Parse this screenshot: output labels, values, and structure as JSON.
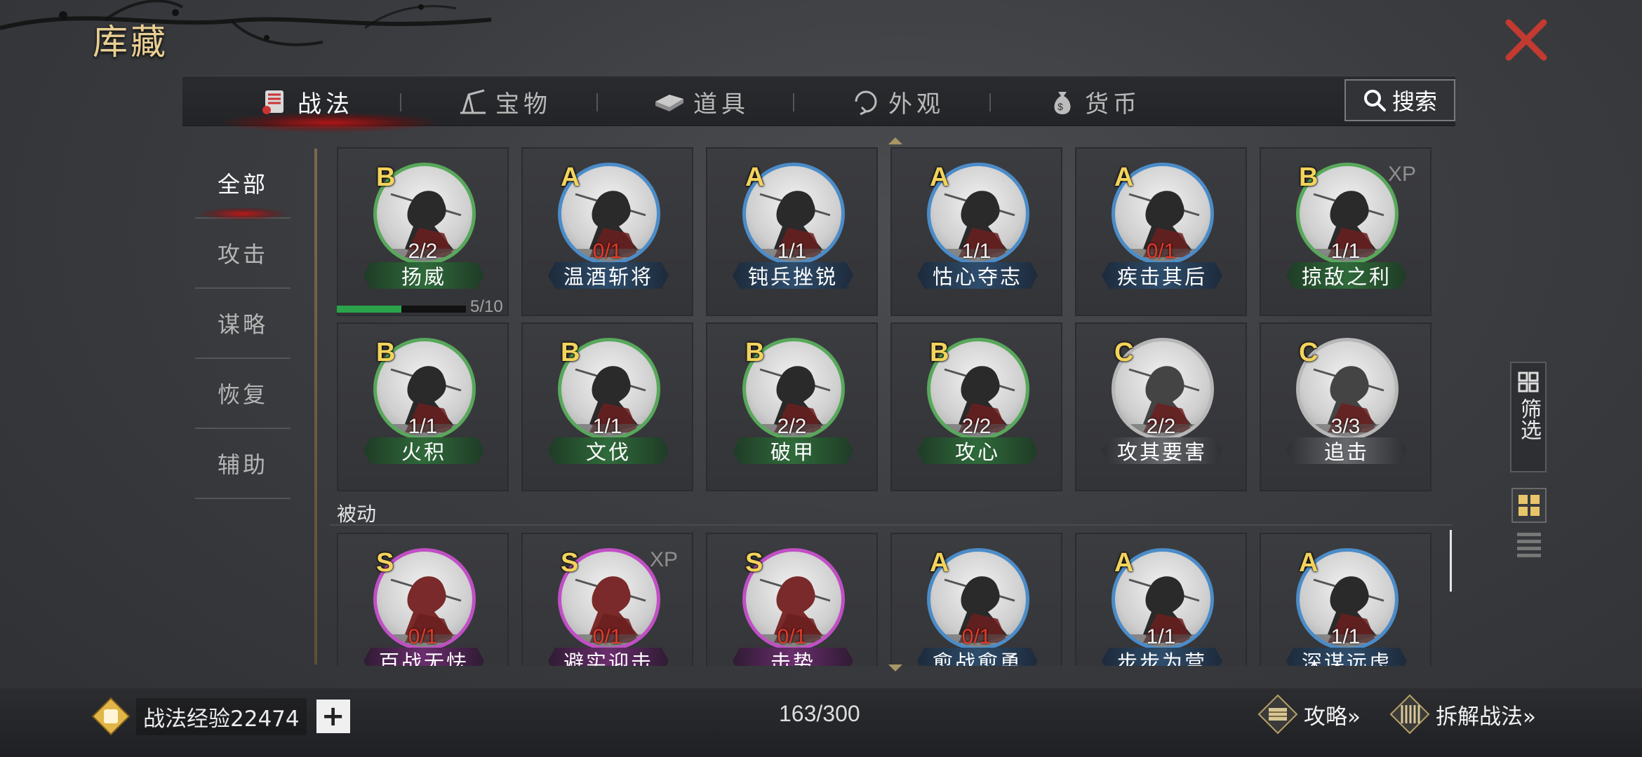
{
  "window": {
    "title": "库藏"
  },
  "tabs": [
    {
      "label": "战法",
      "icon": "scroll-icon",
      "active": true
    },
    {
      "label": "宝物",
      "icon": "treasure-icon",
      "active": false
    },
    {
      "label": "道具",
      "icon": "item-icon",
      "active": false
    },
    {
      "label": "外观",
      "icon": "appearance-icon",
      "active": false
    },
    {
      "label": "货币",
      "icon": "money-bag-icon",
      "active": false
    }
  ],
  "search": {
    "label": "搜索"
  },
  "categories": [
    {
      "label": "全部",
      "active": true
    },
    {
      "label": "攻击",
      "active": false
    },
    {
      "label": "谋略",
      "active": false
    },
    {
      "label": "恢复",
      "active": false
    },
    {
      "label": "辅助",
      "active": false
    }
  ],
  "active_cards_row1": [
    {
      "rank": "B",
      "count": "2/2",
      "name": "扬威",
      "ring": "green",
      "count_red": false,
      "xp": ""
    },
    {
      "rank": "A",
      "count": "0/1",
      "name": "温酒斩将",
      "ring": "blue",
      "count_red": true,
      "xp": ""
    },
    {
      "rank": "A",
      "count": "1/1",
      "name": "钝兵挫锐",
      "ring": "blue",
      "count_red": false,
      "xp": ""
    },
    {
      "rank": "A",
      "count": "1/1",
      "name": "怙心夺志",
      "ring": "blue",
      "count_red": false,
      "xp": ""
    },
    {
      "rank": "A",
      "count": "0/1",
      "name": "疾击其后",
      "ring": "blue",
      "count_red": true,
      "xp": ""
    },
    {
      "rank": "B",
      "count": "1/1",
      "name": "掠敌之利",
      "ring": "green",
      "count_red": false,
      "xp": "XP"
    }
  ],
  "active_cards_row2": [
    {
      "rank": "B",
      "count": "1/1",
      "name": "火积",
      "ring": "green",
      "count_red": false,
      "xp": ""
    },
    {
      "rank": "B",
      "count": "1/1",
      "name": "文伐",
      "ring": "green",
      "count_red": false,
      "xp": ""
    },
    {
      "rank": "B",
      "count": "2/2",
      "name": "破甲",
      "ring": "green",
      "count_red": false,
      "xp": ""
    },
    {
      "rank": "B",
      "count": "2/2",
      "name": "攻心",
      "ring": "green",
      "count_red": false,
      "xp": ""
    },
    {
      "rank": "C",
      "count": "2/2",
      "name": "攻其要害",
      "ring": "gray",
      "count_red": false,
      "xp": ""
    },
    {
      "rank": "C",
      "count": "3/3",
      "name": "追击",
      "ring": "gray",
      "count_red": false,
      "xp": ""
    }
  ],
  "progress": {
    "text": "5/10",
    "fraction": 0.5
  },
  "passive_section": {
    "label": "被动"
  },
  "passive_cards": [
    {
      "rank": "S",
      "count": "0/1",
      "name": "百战无怯",
      "ring": "purple",
      "count_red": true,
      "xp": ""
    },
    {
      "rank": "S",
      "count": "0/1",
      "name": "避实迎击",
      "ring": "purple",
      "count_red": true,
      "xp": "XP"
    },
    {
      "rank": "S",
      "count": "0/1",
      "name": "击势",
      "ring": "purple",
      "count_red": true,
      "xp": ""
    },
    {
      "rank": "A",
      "count": "0/1",
      "name": "愈战愈勇",
      "ring": "blue",
      "count_red": true,
      "xp": ""
    },
    {
      "rank": "A",
      "count": "1/1",
      "name": "步步为营",
      "ring": "blue",
      "count_red": false,
      "xp": ""
    },
    {
      "rank": "A",
      "count": "1/1",
      "name": "深谋远虑",
      "ring": "blue",
      "count_red": false,
      "xp": ""
    }
  ],
  "filter": {
    "label": "筛选"
  },
  "bottom": {
    "exp_label": "战法经验22474",
    "plus_label": "+",
    "total": "163/300",
    "strategy_label": "攻略»",
    "dismantle_label": "拆解战法»"
  },
  "colors": {
    "accent_gold": "#e9cf93",
    "rank_yellow": "#f3d35b",
    "alert_red": "#e23b2a",
    "close_red": "#c0392b"
  }
}
